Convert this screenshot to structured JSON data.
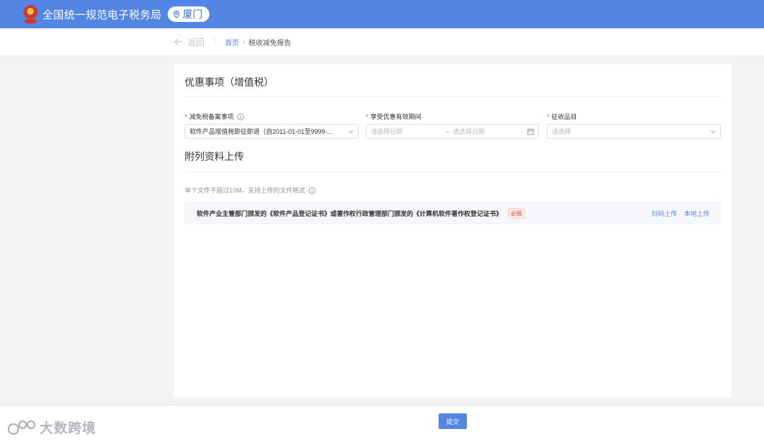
{
  "header": {
    "site_title": "全国统一规范电子税务局",
    "city": "厦门",
    "colors": {
      "brand_blue": "#5386e4",
      "badge_bg": "#ffffff"
    },
    "icons": {
      "logo": "national-emblem-icon",
      "location": "location-pin-icon"
    }
  },
  "subbar": {
    "back_label": "返回",
    "breadcrumb": {
      "home": "首页",
      "separator": "›",
      "current": "税收减免报告"
    }
  },
  "section_preferential": {
    "title": "优惠事项（增值税）",
    "fields": {
      "filing_item": {
        "label": "减免税备案事项",
        "required_mark": "*",
        "value": "软件产品增值税即征即退（自2011-01-01至9999-...",
        "icon": "info-circle-icon"
      },
      "validity_period": {
        "label": "享受优惠有效期间",
        "required_mark": "*",
        "start_placeholder": "请选择日期",
        "range_separator": "-",
        "end_placeholder": "请选择日期",
        "icon": "calendar-icon"
      },
      "tax_item": {
        "label": "征收品目",
        "required_mark": "*",
        "placeholder": "请选择"
      }
    }
  },
  "section_attachments": {
    "title": "附列资料上传",
    "hint": "单个文件不超过10M，支持上传的文件格式",
    "items": [
      {
        "name": "软件产业主管部门颁发的《软件产品登记证书》或著作权行政管理部门颁发的《计算机软件著作权登记证书》",
        "tag": "必报",
        "actions": {
          "scan_upload": "扫码上传",
          "local_upload": "本地上传"
        }
      }
    ]
  },
  "footer": {
    "submit_label": "提交"
  },
  "watermark": {
    "text": "大数跨境"
  }
}
